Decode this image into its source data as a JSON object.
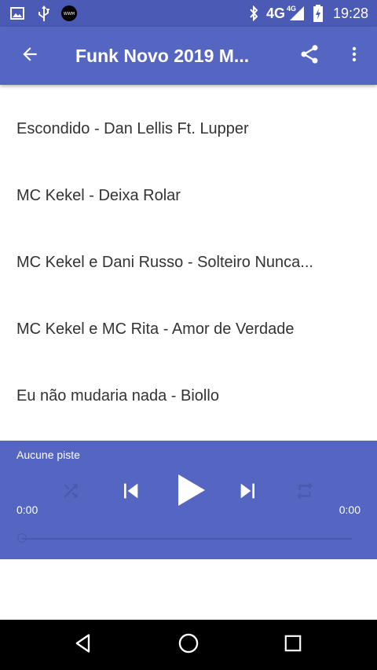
{
  "status_bar": {
    "network": "4G",
    "network_small": "4G",
    "time": "19:28",
    "icons": [
      "image-icon",
      "usb-icon",
      "wwm-icon",
      "bluetooth-icon",
      "signal-icon",
      "battery-charging-icon"
    ]
  },
  "app_bar": {
    "title": "Funk Novo 2019 M...",
    "back_icon": "arrow-left-icon",
    "share_icon": "share-icon",
    "menu_icon": "more-vert-icon"
  },
  "tracks": [
    {
      "title": "Escondido - Dan Lellis Ft. Lupper"
    },
    {
      "title": "MC Kekel - Deixa Rolar"
    },
    {
      "title": "MC Kekel e Dani Russo - Solteiro Nunca..."
    },
    {
      "title": "MC Kekel e MC Rita - Amor de Verdade"
    },
    {
      "title": "Eu não mudaria nada - Biollo"
    }
  ],
  "player": {
    "track_label": "Aucune piste",
    "elapsed": "0:00",
    "duration": "0:00",
    "progress": 0,
    "shuffle_icon": "shuffle-icon",
    "previous_icon": "skip-previous-icon",
    "play_icon": "play-icon",
    "next_icon": "skip-next-icon",
    "repeat_icon": "repeat-icon"
  },
  "nav_bar": {
    "back_icon": "nav-back-icon",
    "home_icon": "nav-home-icon",
    "recents_icon": "nav-recents-icon"
  },
  "colors": {
    "status_bar": "#4b5ab5",
    "primary": "#5566c2",
    "player_dim": "#4a59ad",
    "text": "#333333"
  }
}
